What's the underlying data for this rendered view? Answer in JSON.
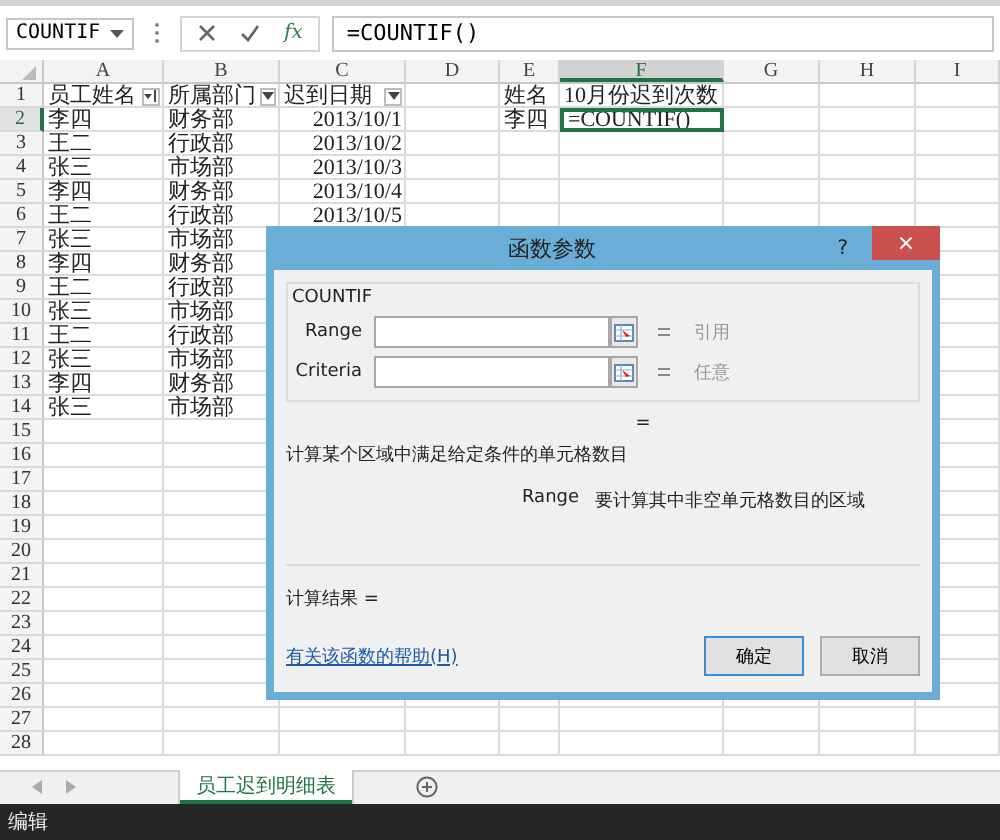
{
  "formula_bar": {
    "name_box": "COUNTIF",
    "function_button": "fx",
    "formula": "=COUNTIF()"
  },
  "columns": [
    {
      "label": "A",
      "kind": "text",
      "selected": false
    },
    {
      "label": "B",
      "kind": "text",
      "selected": false
    },
    {
      "label": "C",
      "kind": "date",
      "selected": false
    },
    {
      "label": "D",
      "kind": "text",
      "selected": false
    },
    {
      "label": "E",
      "kind": "text",
      "selected": false
    },
    {
      "label": "F",
      "kind": "text",
      "selected": true
    },
    {
      "label": "G",
      "kind": "text",
      "selected": false
    },
    {
      "label": "H",
      "kind": "text",
      "selected": false
    },
    {
      "label": "I",
      "kind": "text",
      "selected": false
    }
  ],
  "rows": [
    {
      "header": "1",
      "selected": false,
      "cells": {
        "A": "员工姓名",
        "B": "所属部门",
        "C": "迟到日期",
        "E": "姓名",
        "F": "10月份迟到次数"
      },
      "filter_buttons": [
        {
          "kind": "sorted"
        },
        {
          "kind": "dropdown"
        },
        {
          "kind": "dropdown"
        }
      ]
    },
    {
      "header": "2",
      "selected": true,
      "cells": {
        "A": "李四",
        "B": "财务部",
        "C": "2013/10/1",
        "E": "李四",
        "F": "=COUNTIF()"
      }
    },
    {
      "header": "3",
      "selected": false,
      "cells": {
        "A": "王二",
        "B": "行政部",
        "C": "2013/10/2"
      }
    },
    {
      "header": "4",
      "selected": false,
      "cells": {
        "A": "张三",
        "B": "市场部",
        "C": "2013/10/3"
      }
    },
    {
      "header": "5",
      "selected": false,
      "cells": {
        "A": "李四",
        "B": "财务部",
        "C": "2013/10/4"
      }
    },
    {
      "header": "6",
      "selected": false,
      "cells": {
        "A": "王二",
        "B": "行政部",
        "C": "2013/10/5"
      }
    },
    {
      "header": "7",
      "selected": false,
      "cells": {
        "A": "张三",
        "B": "市场部"
      }
    },
    {
      "header": "8",
      "selected": false,
      "cells": {
        "A": "李四",
        "B": "财务部"
      }
    },
    {
      "header": "9",
      "selected": false,
      "cells": {
        "A": "王二",
        "B": "行政部"
      }
    },
    {
      "header": "10",
      "selected": false,
      "cells": {
        "A": "张三",
        "B": "市场部"
      }
    },
    {
      "header": "11",
      "selected": false,
      "cells": {
        "A": "王二",
        "B": "行政部"
      }
    },
    {
      "header": "12",
      "selected": false,
      "cells": {
        "A": "张三",
        "B": "市场部"
      }
    },
    {
      "header": "13",
      "selected": false,
      "cells": {
        "A": "李四",
        "B": "财务部"
      }
    },
    {
      "header": "14",
      "selected": false,
      "cells": {
        "A": "张三",
        "B": "市场部"
      }
    },
    {
      "header": "15",
      "selected": false,
      "cells": {}
    },
    {
      "header": "16",
      "selected": false,
      "cells": {}
    },
    {
      "header": "17",
      "selected": false,
      "cells": {}
    },
    {
      "header": "18",
      "selected": false,
      "cells": {}
    },
    {
      "header": "19",
      "selected": false,
      "cells": {}
    },
    {
      "header": "20",
      "selected": false,
      "cells": {}
    },
    {
      "header": "21",
      "selected": false,
      "cells": {}
    },
    {
      "header": "22",
      "selected": false,
      "cells": {}
    },
    {
      "header": "23",
      "selected": false,
      "cells": {}
    },
    {
      "header": "24",
      "selected": false,
      "cells": {}
    },
    {
      "header": "25",
      "selected": false,
      "cells": {}
    },
    {
      "header": "26",
      "selected": false,
      "cells": {}
    },
    {
      "header": "27",
      "selected": false,
      "cells": {}
    },
    {
      "header": "28",
      "selected": false,
      "cells": {}
    }
  ],
  "dialog": {
    "title": "函数参数",
    "help_button": "?",
    "close_button": "×",
    "function_name": "COUNTIF",
    "arguments": [
      {
        "label": "Range",
        "value_hint": "引用"
      },
      {
        "label": "Criteria",
        "value_hint": "任意"
      }
    ],
    "result_equals": "=",
    "description": "计算某个区域中满足给定条件的单元格数目",
    "argument_help": {
      "name": "Range",
      "text": "要计算其中非空单元格数目的区域"
    },
    "result_label": "计算结果 =",
    "help_link": "有关该函数的帮助(H)",
    "buttons": [
      "确定",
      "取消"
    ]
  },
  "sheet_tabs": [
    {
      "label": "员工迟到明细表",
      "selected": true
    }
  ],
  "status_bar": {
    "mode": "编辑"
  }
}
